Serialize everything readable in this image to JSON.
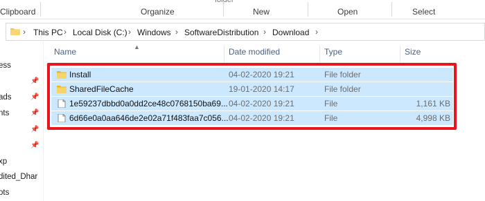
{
  "ribbon": {
    "groups": [
      "Clipboard",
      "Organize",
      "New",
      "Open",
      "Select"
    ],
    "cut_labels": [
      "folder"
    ]
  },
  "address": {
    "crumbs": [
      "This PC",
      "Local Disk (C:)",
      "Windows",
      "SoftwareDistribution",
      "Download"
    ]
  },
  "nav": {
    "items": [
      "ess",
      "ads",
      "nts",
      "xp",
      "dited_Dhar",
      "ots"
    ]
  },
  "columns": {
    "name": "Name",
    "date": "Date modified",
    "type": "Type",
    "size": "Size"
  },
  "files": [
    {
      "name": "Install",
      "date": "04-02-2020 19:21",
      "type": "File folder",
      "size": "",
      "icon": "folder-icon"
    },
    {
      "name": "SharedFileCache",
      "date": "19-01-2020 14:17",
      "type": "File folder",
      "size": "",
      "icon": "folder-icon"
    },
    {
      "name": "1e59237dbbd0a0dd2ce48c0768150ba69...",
      "date": "04-02-2020 19:21",
      "type": "File",
      "size": "1,161 KB",
      "icon": "file-icon"
    },
    {
      "name": "6d66e0a0aa646de2e02a71f483faa7c056...",
      "date": "04-02-2020 19:21",
      "type": "File",
      "size": "4,998 KB",
      "icon": "file-icon"
    }
  ],
  "colors": {
    "selection": "#cce8ff",
    "highlight_border": "#e8141e",
    "folder": "#f2c94c"
  }
}
